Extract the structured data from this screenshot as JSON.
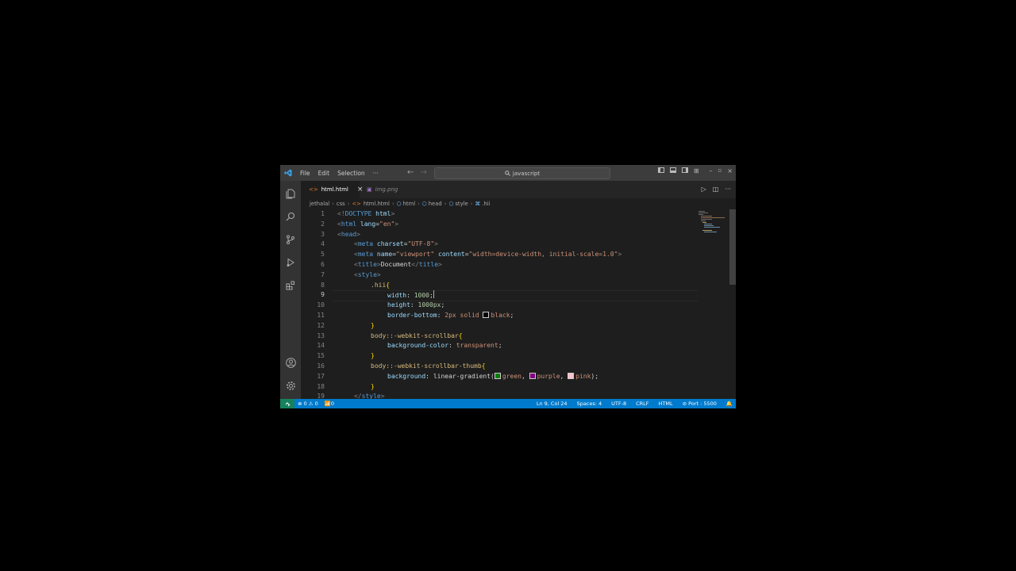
{
  "menu": {
    "file": "File",
    "edit": "Edit",
    "selection": "Selection",
    "more": "···"
  },
  "search": {
    "text": "javascript"
  },
  "tabs": [
    {
      "label": "html.html",
      "close": "×"
    },
    {
      "label": "img.png"
    }
  ],
  "breadcrumb": [
    "jethalal",
    "css",
    "html.html",
    "html",
    "head",
    "style",
    ".hii"
  ],
  "editor": {
    "current_line": 9,
    "lines": [
      {
        "n": "1"
      },
      {
        "n": "2"
      },
      {
        "n": "3"
      },
      {
        "n": "4"
      },
      {
        "n": "5"
      },
      {
        "n": "6"
      },
      {
        "n": "7"
      },
      {
        "n": "8"
      },
      {
        "n": "9"
      },
      {
        "n": "10"
      },
      {
        "n": "11"
      },
      {
        "n": "12"
      },
      {
        "n": "13"
      },
      {
        "n": "14"
      },
      {
        "n": "15"
      },
      {
        "n": "16"
      },
      {
        "n": "17"
      },
      {
        "n": "18"
      },
      {
        "n": "19"
      }
    ],
    "tokens": {
      "l1a": "<!",
      "l1b": "DOCTYPE",
      "l1c": " html",
      "l1d": ">",
      "l2a": "<",
      "l2b": "html",
      "l2c": " lang",
      "l2d": "=",
      "l2e": "\"en\"",
      "l2f": ">",
      "l3a": "<",
      "l3b": "head",
      "l3c": ">",
      "l4a": "<",
      "l4b": "meta",
      "l4c": " charset",
      "l4d": "=",
      "l4e": "\"UTF-8\"",
      "l4f": ">",
      "l5a": "<",
      "l5b": "meta",
      "l5c": " name",
      "l5d": "=",
      "l5e": "\"viewport\"",
      "l5f": " content",
      "l5g": "=",
      "l5h": "\"width=device-width, initial-scale=1.0\"",
      "l5i": ">",
      "l6a": "<",
      "l6b": "title",
      "l6c": ">",
      "l6d": "Document",
      "l6e": "</",
      "l6f": "title",
      "l6g": ">",
      "l7a": "<",
      "l7b": "style",
      "l7c": ">",
      "l8a": ".hii",
      "l8b": "{",
      "l9a": "width",
      "l9b": ": ",
      "l9c": "1000",
      "l9d": ";",
      "l10a": "height",
      "l10b": ": ",
      "l10c": "1000px",
      "l10d": ";",
      "l11a": "border-bottom",
      "l11b": ": ",
      "l11c": "2px solid ",
      "l11d": "black",
      "l11e": ";",
      "l12a": "}",
      "l13a": "body::-webkit-scrollbar",
      "l13b": "{",
      "l14a": "background-color",
      "l14b": ": ",
      "l14c": "transparent",
      "l14d": ";",
      "l15a": "}",
      "l16a": "body::-webkit-scrollbar-thumb",
      "l16b": "{",
      "l17a": "background",
      "l17b": ": ",
      "l17c": "linear-gradient(",
      "l17d": "green",
      "l17e": ", ",
      "l17f": "purple",
      "l17g": ", ",
      "l17h": "pink",
      "l17i": ");",
      "l18a": "}",
      "l19a": "</",
      "l19b": "style",
      "l19c": ">"
    }
  },
  "status": {
    "errors": "0",
    "warnings": "0",
    "ports": "0",
    "position": "Ln 9, Col 24",
    "spaces": "Spaces: 4",
    "encoding": "UTF-8",
    "eol": "CRLF",
    "language": "HTML",
    "port": "Port : 5500"
  },
  "colors": {
    "accent": "#007acc",
    "remote": "#16825d",
    "titlebar": "#3c3c3c",
    "editor_bg": "#1e1e1e"
  }
}
